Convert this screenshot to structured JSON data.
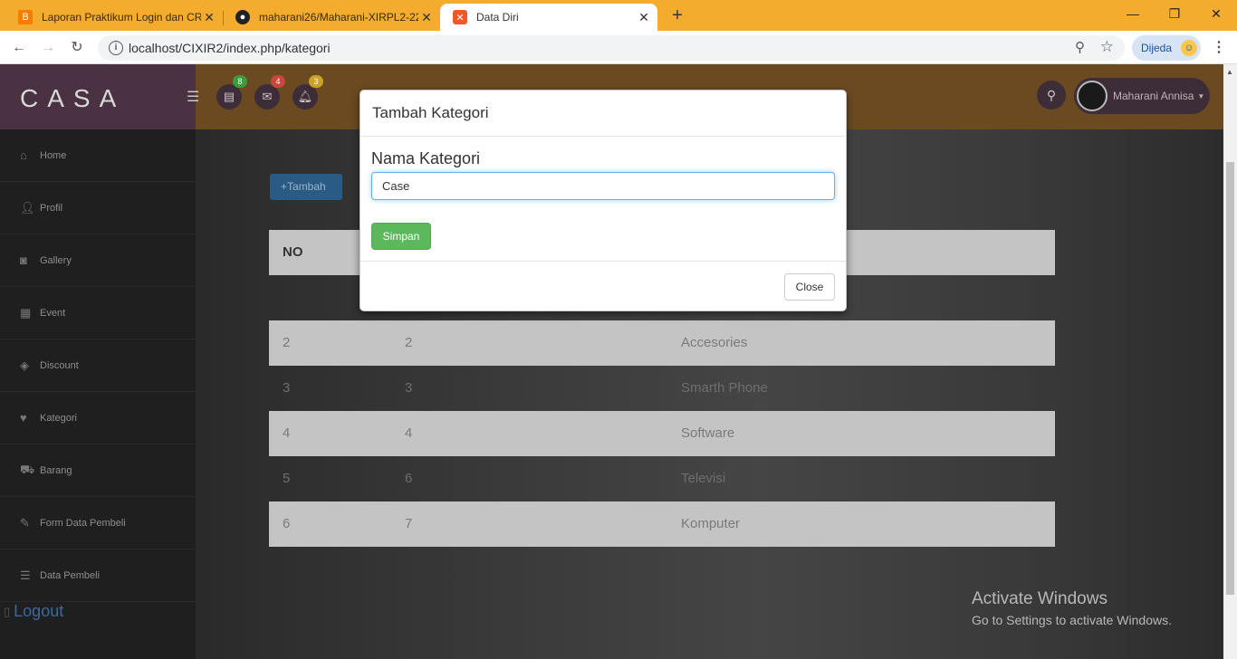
{
  "browser": {
    "tabs": [
      {
        "title": "Laporan Praktikum Login dan CR",
        "state": "inactive"
      },
      {
        "title": "maharani26/Maharani-XIRPL2-22",
        "state": "inactive"
      },
      {
        "title": "Data Diri",
        "state": "active"
      }
    ],
    "url": "localhost/CIXIR2/index.php/kategori",
    "profile_label": "Dijeda"
  },
  "app": {
    "brand": "CASA",
    "badges": {
      "tasks": "8",
      "messages": "4",
      "notifications": "3"
    },
    "user_name": "Maharani Annisa"
  },
  "sidebar": {
    "items": [
      {
        "label": "Home",
        "icon": "home-icon"
      },
      {
        "label": "Profil",
        "icon": "user-icon"
      },
      {
        "label": "Gallery",
        "icon": "camera-icon"
      },
      {
        "label": "Event",
        "icon": "gift-icon"
      },
      {
        "label": "Discount",
        "icon": "tag-icon"
      },
      {
        "label": "Kategori",
        "icon": "heart-icon"
      },
      {
        "label": "Barang",
        "icon": "cart-icon"
      },
      {
        "label": "Form Data Pembeli",
        "icon": "pencil-icon"
      },
      {
        "label": "Data Pembeli",
        "icon": "list-icon"
      }
    ],
    "logout_label": "Logout"
  },
  "main": {
    "add_button_label": "Tambah",
    "table": {
      "header": {
        "col1": "NO"
      },
      "rows": [
        {
          "no": "2",
          "id": "2",
          "nama": "Accesories"
        },
        {
          "no": "3",
          "id": "3",
          "nama": "Smarth Phone"
        },
        {
          "no": "4",
          "id": "4",
          "nama": "Software"
        },
        {
          "no": "5",
          "id": "6",
          "nama": "Televisi"
        },
        {
          "no": "6",
          "id": "7",
          "nama": "Komputer"
        }
      ]
    }
  },
  "modal": {
    "title": "Tambah Kategori",
    "field_label": "Nama Kategori",
    "field_value": "Case",
    "save_label": "Simpan",
    "close_label": "Close"
  },
  "watermark": {
    "line1": "Activate Windows",
    "line2": "Go to Settings to activate Windows."
  }
}
